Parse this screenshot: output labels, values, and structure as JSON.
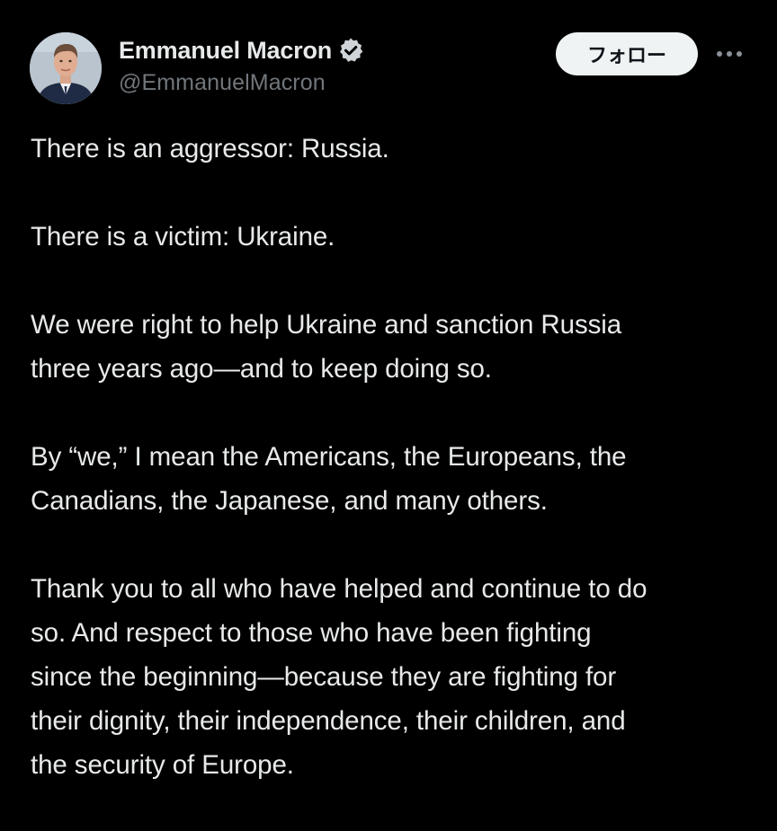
{
  "post": {
    "author": {
      "display_name": "Emmanuel Macron",
      "handle": "@EmmanuelMacron",
      "verified": true,
      "verified_icon": "verified-badge-icon",
      "avatar_icon": "profile-photo"
    },
    "follow_label": "フォロー",
    "more_icon": "more-dots-icon",
    "paragraphs": [
      {
        "lines": [
          "There is an aggressor: Russia."
        ]
      },
      {
        "lines": [
          "There is a victim: Ukraine."
        ]
      },
      {
        "lines": [
          "We were right to help Ukraine and sanction Russia",
          "three years ago—and to keep doing so."
        ]
      },
      {
        "lines": [
          "By “we,” I mean the Americans, the Europeans, the",
          "Canadians, the Japanese, and many others."
        ]
      },
      {
        "lines": [
          "Thank you to all who have helped and continue to do",
          "so. And respect to those who have been fighting",
          "since the beginning—because they are fighting for",
          "their dignity, their independence, their children, and",
          "the security of Europe."
        ]
      }
    ]
  },
  "colors": {
    "background": "#000000",
    "text_primary": "#e7e9ea",
    "text_secondary": "#71767b",
    "button_bg": "#eff3f4",
    "button_text": "#0f1419"
  }
}
